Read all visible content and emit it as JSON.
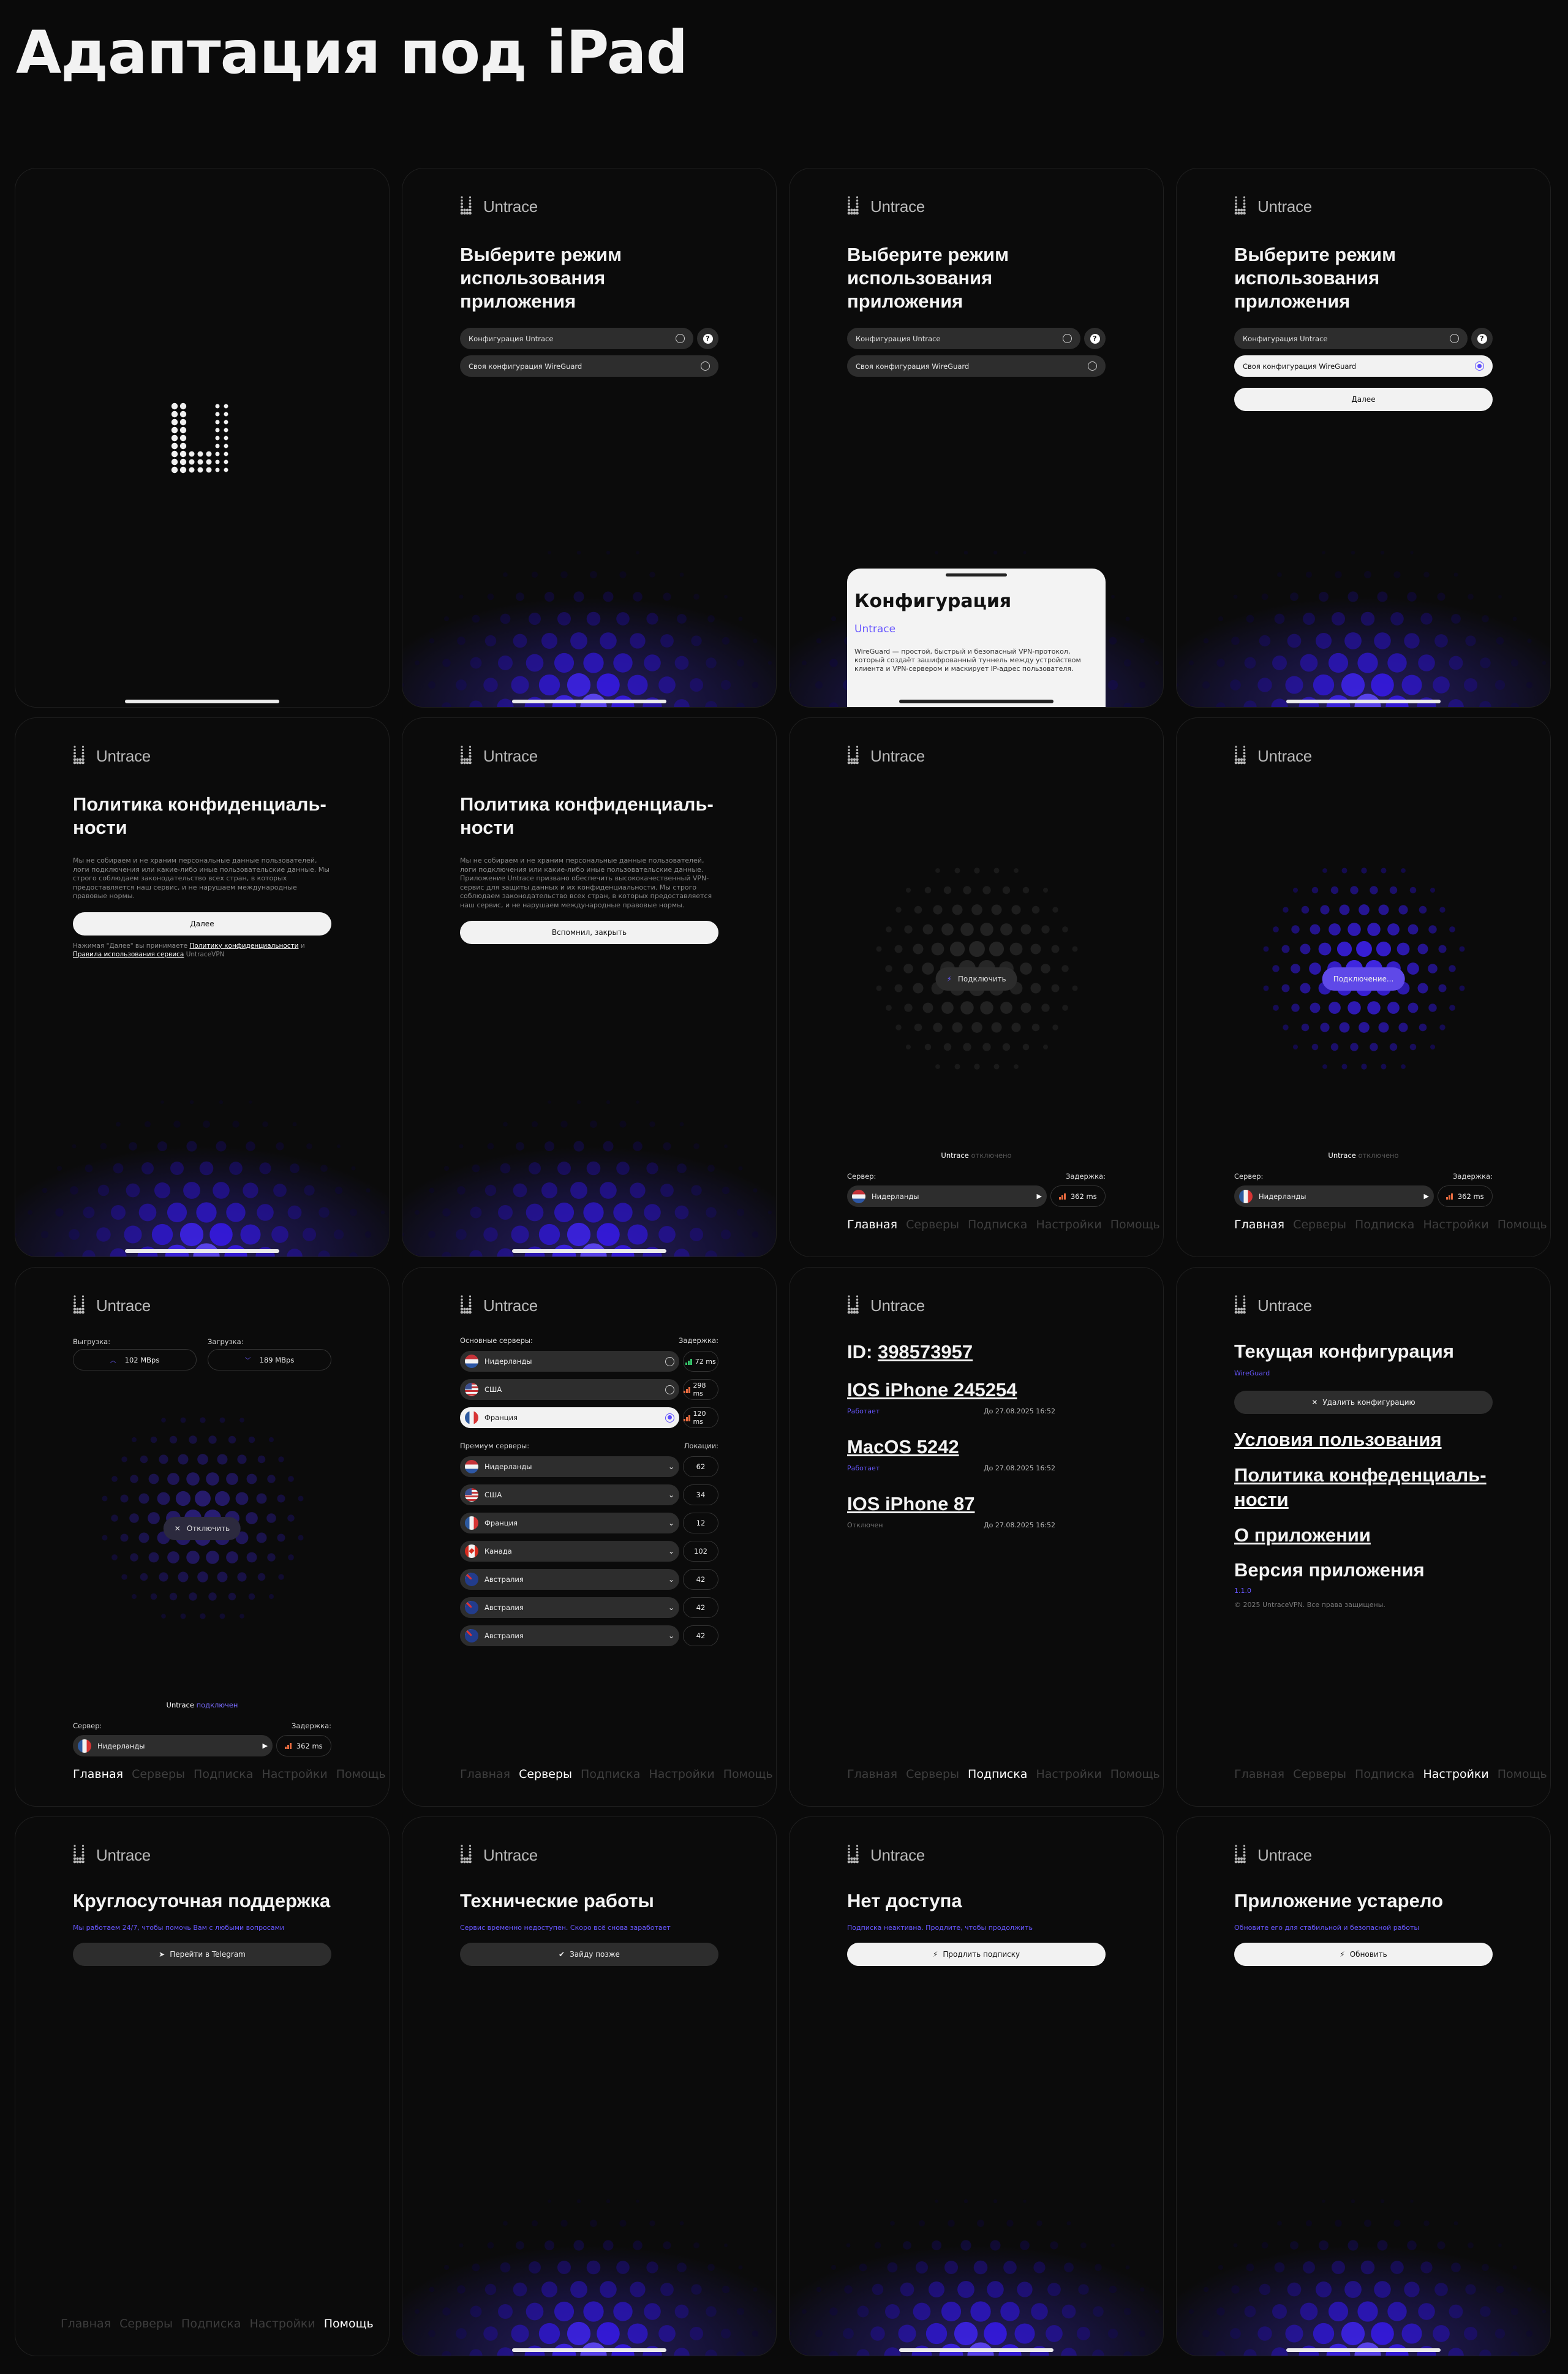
{
  "page_title": "Адаптация под iPad",
  "brand": "Untrace",
  "mode": {
    "title": "Выберите режим использования приложения",
    "opt1": "Конфигурация Untrace",
    "opt2": "Своя конфигурация WireGuard",
    "help": "?",
    "next": "Далее"
  },
  "sheet": {
    "title": "Конфигурация",
    "subtitle": "Untrace",
    "text": "WireGuard — простой, быстрый и безопасный VPN-протокол, который создаёт зашифрованный туннель между устройством клиента и VPN-сервером и маскирует IP-адрес пользователя."
  },
  "privacy": {
    "title": "Политика конфиденциаль-ности",
    "text1": "Мы не собираем и не храним персональные данные пользователей, логи подключения или какие-либо иные пользовательские данные. Мы строго соблюдаем законодательство всех стран, в которых предоставляется наш сервис, и не нарушаем международные правовые нормы.",
    "text2": "Мы не собираем и не храним персональные данные пользователей, логи подключения или какие-либо иные пользовательские данные. Приложение Untrace призвано обеспечить высококачественный VPN-сервис для защиты данных и их конфиденциальности. Мы строго соблюдаем законодательство всех стран, в которых предоставляется наш сервис, и не нарушаем международные правовые нормы.",
    "next": "Далее",
    "close": "Вспомнил, закрыть",
    "consent_pre": "Нажимая \"Далее\" вы принимаете",
    "consent_link1": "Политику конфиденциальности",
    "consent_mid": "и",
    "consent_link2": "Правила использования сервиса",
    "consent_post": "UntraceVPN"
  },
  "home": {
    "connect": "Подключить",
    "connecting": "Подключение...",
    "disconnect": "Отключить",
    "status_off": "отключено",
    "status_on": "подключен",
    "server_label": "Сервер:",
    "latency_label": "Задержка:",
    "server": "Нидерланды",
    "latency": "362 ms",
    "upload_label": "Выгрузка:",
    "download_label": "Загрузка:",
    "upload": "102 MBps",
    "download": "189 MBps"
  },
  "tabs": [
    "Главная",
    "Серверы",
    "Подписка",
    "Настройки",
    "Помощь"
  ],
  "servers": {
    "main_label": "Основные серверы:",
    "latency_label": "Задержка:",
    "premium_label": "Премиум серверы:",
    "locations_label": "Локации:",
    "main": [
      {
        "name": "Нидерланды",
        "flag": "nl",
        "latency": "72 ms"
      },
      {
        "name": "США",
        "flag": "us",
        "latency": "298 ms"
      },
      {
        "name": "Франция",
        "flag": "fr",
        "latency": "120 ms"
      }
    ],
    "premium": [
      {
        "name": "Нидерланды",
        "flag": "nl",
        "count": "62"
      },
      {
        "name": "США",
        "flag": "us",
        "count": "34"
      },
      {
        "name": "Франция",
        "flag": "fr",
        "count": "12"
      },
      {
        "name": "Канада",
        "flag": "ca",
        "count": "102"
      },
      {
        "name": "Австралия",
        "flag": "au",
        "count": "42"
      },
      {
        "name": "Австралия",
        "flag": "au",
        "count": "42"
      },
      {
        "name": "Австралия",
        "flag": "au",
        "count": "42"
      }
    ]
  },
  "subscription": {
    "id_label": "ID:",
    "id": "398573957",
    "devices": [
      {
        "name": "IOS iPhone 245254",
        "status": "Работает",
        "date": "До 27.08.2025 16:52"
      },
      {
        "name": "MacOS 5242",
        "status": "Работает",
        "date": "До 27.08.2025 16:52"
      },
      {
        "name": "IOS iPhone 87",
        "status": "Отключен",
        "date": "До 27.08.2025 16:52"
      }
    ]
  },
  "settings": {
    "current": "Текущая конфигурация",
    "current_value": "WireGuard",
    "delete": "Удалить конфигурацию",
    "terms": "Условия пользования",
    "policy": "Политика конфеденциаль-ности",
    "about": "О приложении",
    "version": "Версия приложения",
    "version_value": "1.1.0",
    "copyright": "© 2025 UntraceVPN. Все права защищены."
  },
  "support": {
    "title": "Круглосуточная поддержка",
    "sub": "Мы работаем 24/7, чтобы помочь Вам с любыми вопросами",
    "button": "Перейти в Telegram"
  },
  "maintenance": {
    "title": "Технические работы",
    "sub": "Сервис временно недоступен. Скоро всё снова заработает",
    "button": "Зайду позже"
  },
  "noaccess": {
    "title": "Нет доступа",
    "sub": "Подписка неактивна. Продлите, чтобы продолжить",
    "button": "Продлить подписку"
  },
  "outdated": {
    "title": "Приложение устарело",
    "sub": "Обновите его для стабильной и безопасной работы",
    "button": "Обновить"
  },
  "colors": {
    "accent": "#5b4bff",
    "background": "#0a0a0a"
  }
}
